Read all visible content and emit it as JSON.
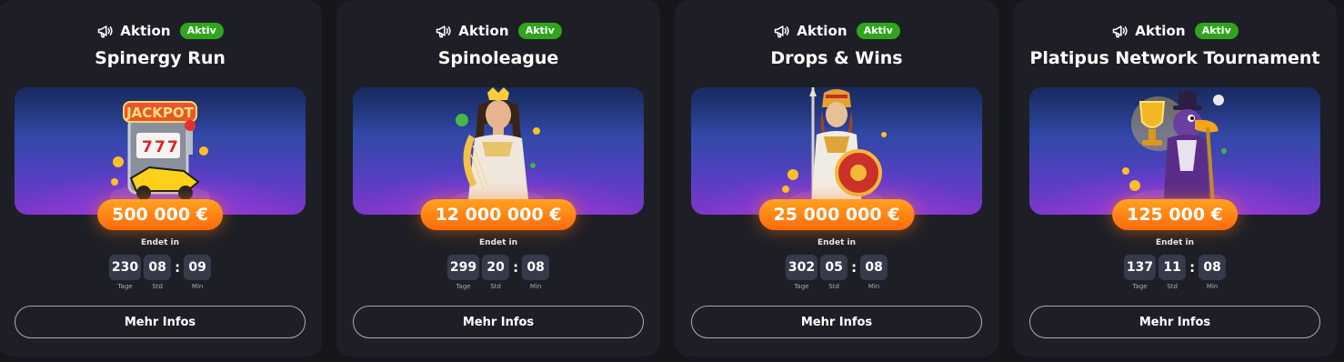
{
  "colors": {
    "page_bg": "#16171d",
    "card_bg": "#1e1f26",
    "badge_green": "#2fa51e",
    "prize_orange": "#ff7d12",
    "timer_box": "#363a4a"
  },
  "promotions": [
    {
      "promo_label": "Aktion",
      "status_badge": "Aktiv",
      "title": "Spinergy Run",
      "art_icon": "jackpot-slot-machine-art",
      "prize": "500 000 €",
      "ends_label": "Endet in",
      "timer": [
        {
          "value": "230",
          "label": "Tage"
        },
        {
          "value": "08",
          "label": "Std"
        },
        {
          "value": "09",
          "label": "Min"
        }
      ],
      "button_label": "Mehr Infos"
    },
    {
      "promo_label": "Aktion",
      "status_badge": "Aktiv",
      "title": "Spinoleague",
      "art_icon": "goddess-harp-art",
      "prize": "12 000 000 €",
      "ends_label": "Endet in",
      "timer": [
        {
          "value": "299",
          "label": "Tage"
        },
        {
          "value": "20",
          "label": "Std"
        },
        {
          "value": "08",
          "label": "Min"
        }
      ],
      "button_label": "Mehr Infos"
    },
    {
      "promo_label": "Aktion",
      "status_badge": "Aktiv",
      "title": "Drops & Wins",
      "art_icon": "warrior-goddess-art",
      "prize": "25 000 000 €",
      "ends_label": "Endet in",
      "timer": [
        {
          "value": "302",
          "label": "Tage"
        },
        {
          "value": "05",
          "label": "Std"
        },
        {
          "value": "08",
          "label": "Min"
        }
      ],
      "button_label": "Mehr Infos"
    },
    {
      "promo_label": "Aktion",
      "status_badge": "Aktiv",
      "title": "Platipus Network Tournament",
      "art_icon": "platypus-trophy-art",
      "prize": "125 000 €",
      "ends_label": "Endet in",
      "timer": [
        {
          "value": "137",
          "label": "Tage"
        },
        {
          "value": "11",
          "label": "Std"
        },
        {
          "value": "08",
          "label": "Min"
        }
      ],
      "button_label": "Mehr Infos"
    }
  ]
}
